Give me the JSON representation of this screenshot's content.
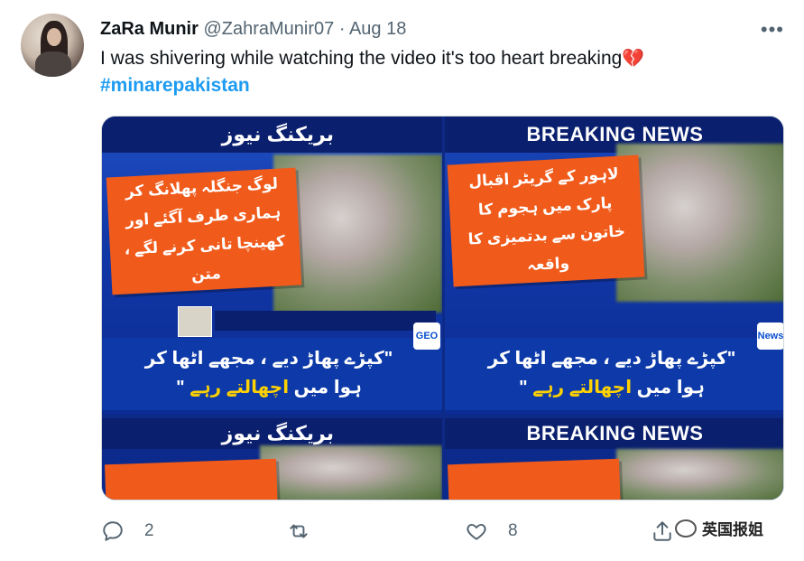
{
  "tweet": {
    "author_name": "ZaRa Munir",
    "handle": "@ZahraMunir07",
    "separator": "·",
    "date": "Aug 18",
    "text": "I was shivering while watching the video it's too heart breaking",
    "emoji": "💔",
    "hashtag": "#minarepakistan",
    "more_label": "•••"
  },
  "media": {
    "panel1": {
      "top_banner": "بریکنگ نیوز",
      "orange_text": "لوگ جنگلہ پھلانگ کر ہماری طرف آگئے اور کھینچا تانی کرنے لگے ، متن",
      "quote_line1": "\"کپڑے پھاڑ دیے ، مجھے اٹھا کر",
      "quote_line2": "ہوا میں",
      "quote_highlight": "اچھالتے رہے",
      "logo": "GEO"
    },
    "panel2": {
      "top_banner": "BREAKING NEWS",
      "orange_text": "لاہور کے گریٹر اقبال پارک میں ہجوم کا خاتون سے بدتمیزی کا واقعہ",
      "quote_line1": "\"کپڑے پھاڑ دیے ، مجھے اٹھا کر",
      "quote_line2": "ہوا میں",
      "quote_highlight": "اچھالتے رہے",
      "logo": "News"
    },
    "panel3": {
      "top_banner": "بریکنگ نیوز"
    },
    "panel4": {
      "top_banner": "BREAKING NEWS"
    }
  },
  "actions": {
    "reply_count": "2",
    "retweet_count": "",
    "like_count": "8"
  },
  "watermark": {
    "text": "英国报姐"
  },
  "colors": {
    "link": "#1d9bf0",
    "secondary_text": "#536471",
    "news_blue": "#1238a8",
    "news_orange": "#f05a1a"
  }
}
